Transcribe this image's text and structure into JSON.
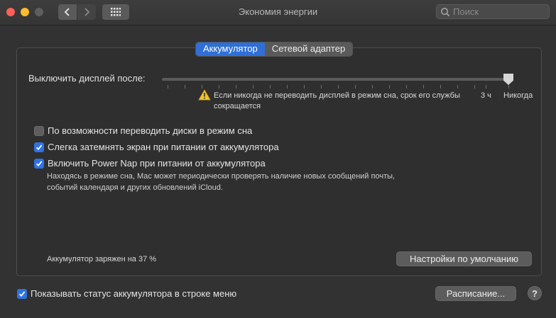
{
  "window": {
    "title": "Экономия энергии"
  },
  "search": {
    "placeholder": "Поиск"
  },
  "tabs": [
    {
      "label": "Аккумулятор",
      "active": true
    },
    {
      "label": "Сетевой адаптер",
      "active": false
    }
  ],
  "display_sleep": {
    "label": "Выключить дисплей после:",
    "value_label": "Никогда",
    "marker_label": "3 ч",
    "warning": "Если никогда не переводить дисплей в режим сна, срок его службы сокращается"
  },
  "options": [
    {
      "label": "По возможности переводить диски в режим сна",
      "checked": false
    },
    {
      "label": "Слегка затемнять экран при питании от аккумулятора",
      "checked": true
    },
    {
      "label": "Включить Power Nap при питании от аккумулятора",
      "checked": true
    }
  ],
  "power_nap_desc": "Находясь в режиме сна, Mac может периодически проверять наличие новых сообщений почты, событий календаря и других обновлений iCloud.",
  "battery": {
    "status": "Аккумулятор заряжен на 37 %"
  },
  "buttons": {
    "defaults": "Настройки по умолчанию",
    "schedule": "Расписание...",
    "help": "?"
  },
  "menu_status": {
    "label": "Показывать статус аккумулятора в строке меню",
    "checked": true
  },
  "colors": {
    "accent": "#2f72e3",
    "warning": "#f2c230"
  },
  "icons": [
    "chevron-left-icon",
    "chevron-right-icon",
    "grid-icon",
    "search-icon",
    "warning-icon",
    "checkmark-icon"
  ]
}
